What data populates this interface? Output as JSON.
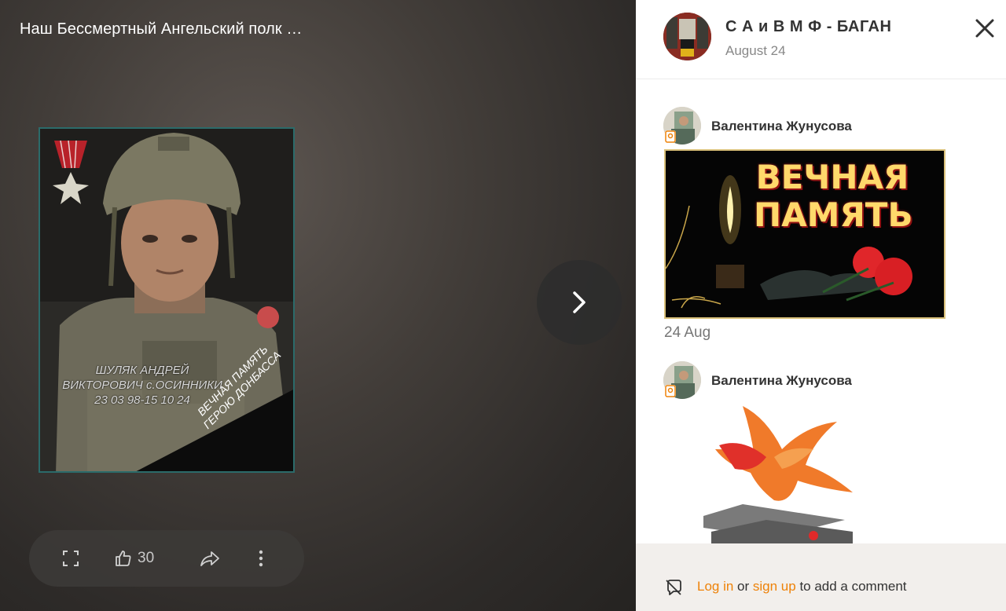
{
  "viewer": {
    "title": "Наш Бессмертный Ангельский полк …",
    "photo": {
      "caption_line1": "ШУЛЯК АНДРЕЙ",
      "caption_line2": "ВИКТОРОВИЧ с.ОСИННИКИ",
      "caption_line3": "23 03 98-15 10 24",
      "ribbon_line1": "ВЕЧНАЯ ПАМЯТЬ",
      "ribbon_line2": "ГЕРОЮ ДОНБАССА"
    },
    "toolbar": {
      "likes": "30"
    }
  },
  "panel": {
    "group_name": "С А и В М Ф - БАГАН",
    "group_date": "August 24",
    "comments": [
      {
        "author": "Валентина Жунусова",
        "image_line1": "ВЕЧНАЯ",
        "image_line2": "ПАМЯТЬ",
        "date": "24 Aug"
      },
      {
        "author": "Валентина Жунусова"
      }
    ],
    "footer": {
      "login": "Log in",
      "or": " or ",
      "signup": "sign up",
      "rest": " to add a comment"
    }
  },
  "colors": {
    "accent": "#ee8208",
    "viewer_bg": "#423d39",
    "footer_bg": "#f2efec"
  },
  "icons": [
    "fullscreen-icon",
    "thumbs-up-icon",
    "share-icon",
    "more-vertical-icon",
    "chevron-right-icon",
    "close-icon",
    "comments-off-icon"
  ]
}
